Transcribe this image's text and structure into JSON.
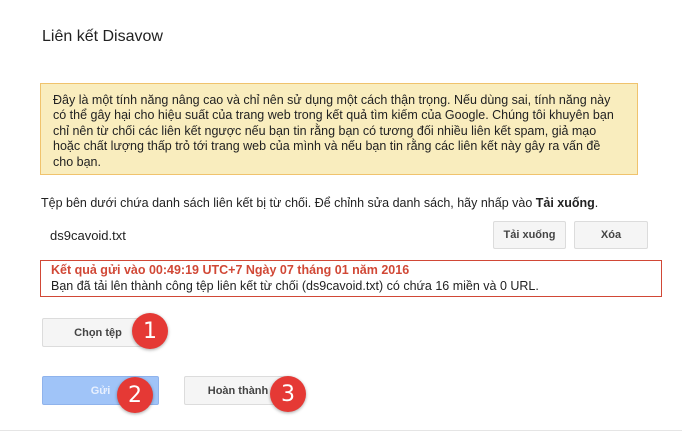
{
  "header": {
    "title": "Liên kết Disavow"
  },
  "warning": {
    "lines": [
      "Đây là một tính năng nâng cao và chỉ nên sử dụng một cách thận trọng. Nếu dùng sai, tính năng này",
      "có thể gây hại cho hiệu suất của trang web trong kết quả tìm kiếm của Google. Chúng tôi khuyên bạn",
      "chỉ nên từ chối các liên kết ngược nếu bạn tin rằng bạn có tương đối nhiều liên kết spam, giả mạo",
      "hoặc chất lượng thấp trỏ tới trang web của mình và nếu bạn tin rằng các liên kết này gây ra vấn đề",
      "cho bạn."
    ]
  },
  "instruction": {
    "text": "Tệp bên dưới chứa danh sách liên kết bị từ chối. Để chỉnh sửa danh sách, hãy nhấp vào ",
    "bold": "Tải xuống",
    "end": "."
  },
  "file": {
    "name": "ds9cavoid.txt",
    "download_label": "Tải xuống",
    "delete_label": "Xóa"
  },
  "result": {
    "title": "Kết quả gửi vào 00:49:19 UTC+7 Ngày 07 tháng 01 năm 2016",
    "message": "Bạn đã tải lên thành công tệp liên kết từ chối (ds9cavoid.txt) có chứa 16 miền và 0 URL."
  },
  "actions": {
    "choose_label": "Chọn tệp",
    "submit_label": "Gửi",
    "done_label": "Hoàn thành"
  },
  "badges": [
    "1",
    "2",
    "3"
  ],
  "colors": {
    "warning_bg": "#f9edbe",
    "error_red": "#d14836",
    "badge_red": "#e53935",
    "submit_blue": "#a0c4f8"
  }
}
